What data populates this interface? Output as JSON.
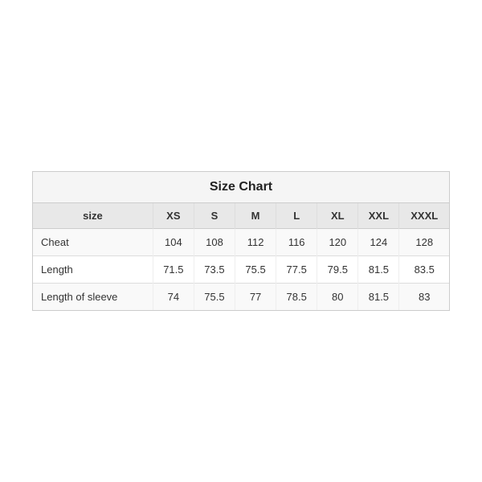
{
  "chart": {
    "title": "Size Chart",
    "columns": [
      "size",
      "XS",
      "S",
      "M",
      "L",
      "XL",
      "XXL",
      "XXXL"
    ],
    "rows": [
      {
        "label": "Cheat",
        "values": [
          "104",
          "108",
          "112",
          "116",
          "120",
          "124",
          "128"
        ]
      },
      {
        "label": "Length",
        "values": [
          "71.5",
          "73.5",
          "75.5",
          "77.5",
          "79.5",
          "81.5",
          "83.5"
        ]
      },
      {
        "label": "Length of sleeve",
        "values": [
          "74",
          "75.5",
          "77",
          "78.5",
          "80",
          "81.5",
          "83"
        ]
      }
    ]
  }
}
